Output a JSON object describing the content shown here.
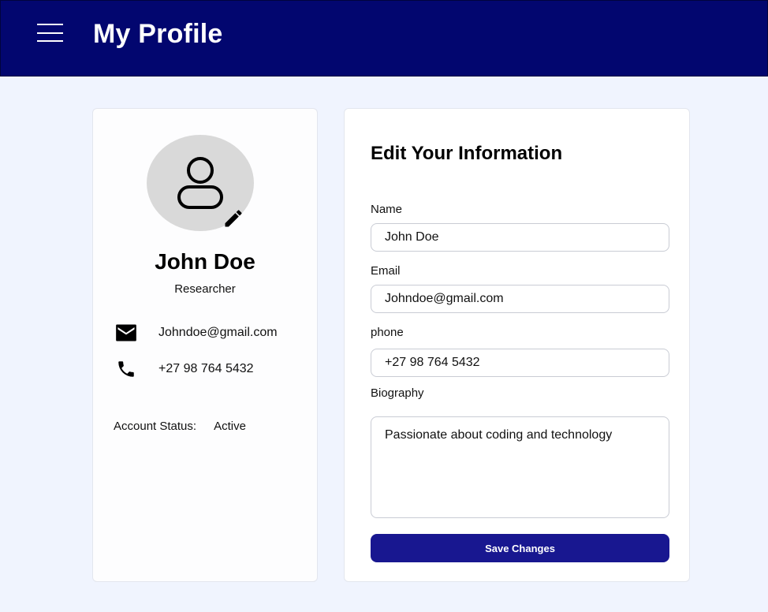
{
  "header": {
    "title": "My Profile",
    "menu_icon": "hamburger-menu-icon",
    "background_color": "#02066f"
  },
  "profile": {
    "avatar_icon": "user-avatar-icon",
    "edit_icon": "pencil-edit-icon",
    "name": "John Doe",
    "role": "Researcher",
    "contacts": [
      {
        "icon": "email-icon",
        "value": "Johndoe@gmail.com"
      },
      {
        "icon": "phone-icon",
        "value": "+27 98 764 5432"
      }
    ],
    "account_status_label": "Account Status:",
    "account_status_value": "Active"
  },
  "form": {
    "heading": "Edit Your Information",
    "name_label": "Name",
    "name_value": "John Doe",
    "email_label": "Email",
    "email_value": "Johndoe@gmail.com",
    "phone_label": "phone",
    "phone_value": "+27 98 764 5432",
    "bio_label": "Biography",
    "bio_value": "Passionate about coding and technology",
    "save_label": "Save Changes",
    "button_color": "#181790"
  }
}
